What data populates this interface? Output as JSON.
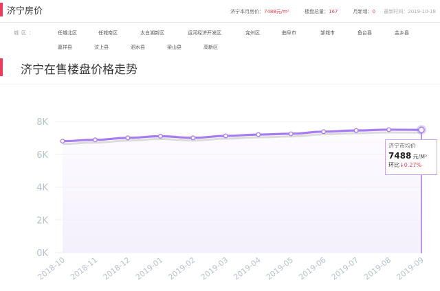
{
  "header": {
    "title": "济宁房价",
    "stats": [
      {
        "label": "济宁本月房价：",
        "value": "7488元/m²"
      },
      {
        "label": "楼盘总量：",
        "value": "167"
      },
      {
        "label": "月新增：",
        "value": "0"
      }
    ],
    "update_label": "最新时间：2019-10-18"
  },
  "region": {
    "label": "城区：",
    "row1": [
      "任城北区",
      "任城南区",
      "太白湖新区",
      "运河经济开发区",
      "兖州区",
      "曲阜市",
      "邹城市",
      "鱼台县",
      "金乡县"
    ],
    "row2": [
      "嘉祥县",
      "汶上县",
      "泗水县",
      "梁山县",
      "高新区"
    ]
  },
  "section": {
    "title": "济宁在售楼盘价格走势"
  },
  "tooltip": {
    "label": "济宁市均价",
    "value": "7488",
    "unit": "元/M²",
    "change_label": "环比",
    "change_arrow": "↓",
    "change_value": "0.27%"
  },
  "colors": {
    "accent": "#ee3b5b",
    "line": "#a77cf0",
    "highlight": "#e8414f"
  },
  "chart_data": {
    "type": "line",
    "title": "",
    "xlabel": "",
    "ylabel": "",
    "categories": [
      "2018-10",
      "2018-11",
      "2018-12",
      "2019-01",
      "2019-02",
      "2019-03",
      "2019-04",
      "2019-05",
      "2019-06",
      "2019-07",
      "2019-08",
      "2019-09"
    ],
    "series": [
      {
        "name": "济宁市均价",
        "values": [
          6800,
          6880,
          7000,
          7100,
          7000,
          7120,
          7200,
          7250,
          7380,
          7450,
          7500,
          7488
        ]
      }
    ],
    "ylim": [
      0,
      8000
    ],
    "yticks": [
      0,
      2000,
      4000,
      6000,
      8000
    ],
    "ytick_labels": [
      "0K",
      "2K",
      "4K",
      "6K",
      "8K"
    ],
    "grid": true,
    "highlight_category": "2019-09"
  }
}
